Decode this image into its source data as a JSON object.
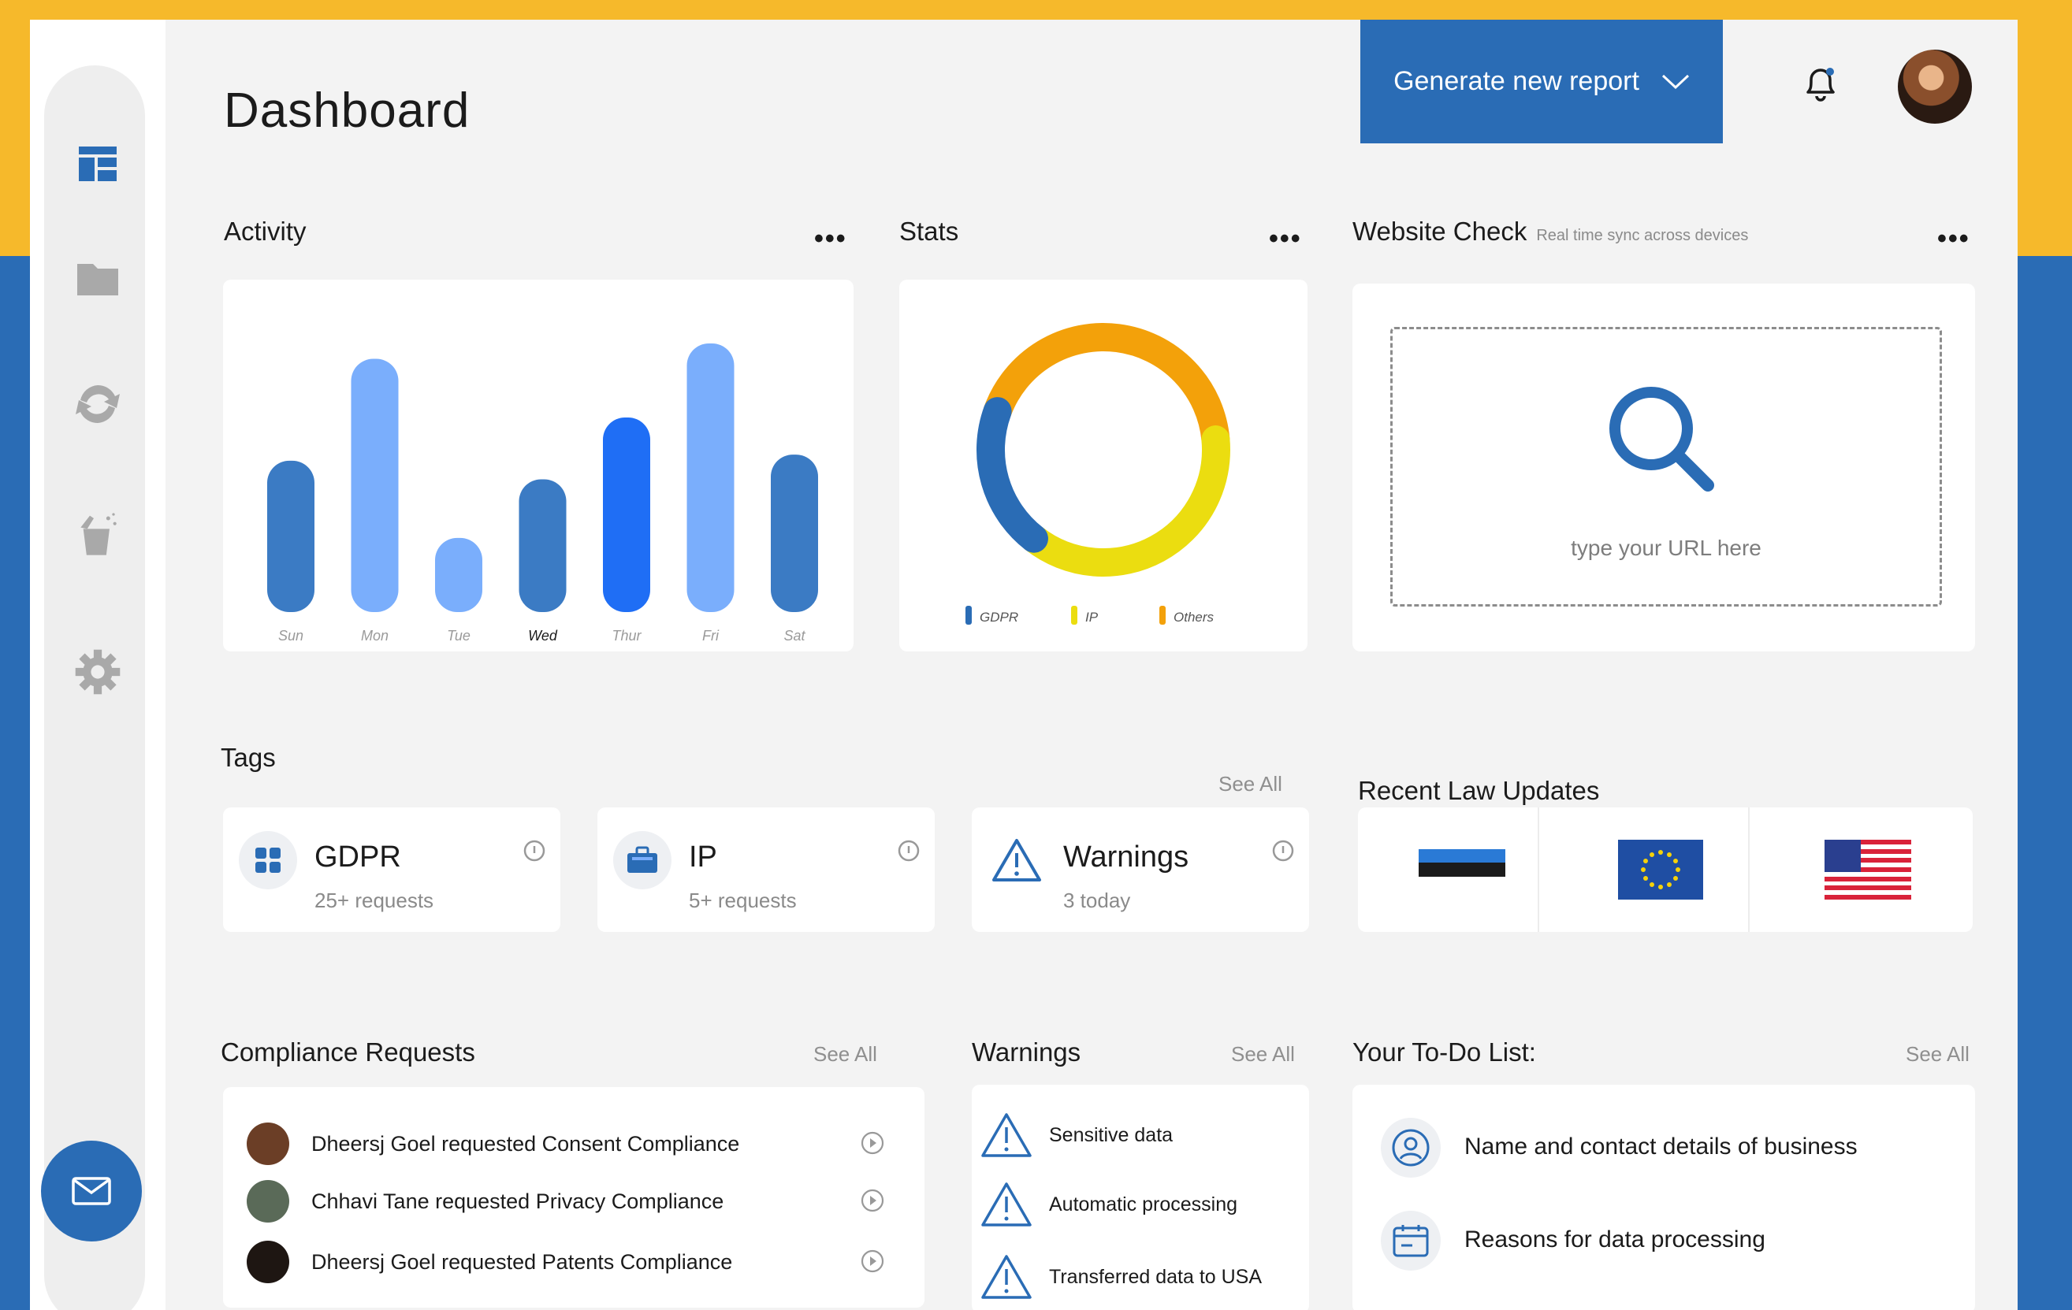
{
  "header": {
    "title": "Dashboard",
    "generate_button": "Generate new report"
  },
  "activity": {
    "title": "Activity",
    "menu": "•••"
  },
  "stats": {
    "title": "Stats",
    "menu": "•••"
  },
  "website_check": {
    "title": "Website Check",
    "subtitle": "Real time sync across devices",
    "menu": "•••",
    "placeholder": "type your URL here"
  },
  "tags": {
    "title": "Tags",
    "see_all": "See All",
    "items": [
      {
        "name": "GDPR",
        "sub": "25+ requests",
        "icon": "grid-icon"
      },
      {
        "name": "IP",
        "sub": "5+ requests",
        "icon": "briefcase-icon"
      },
      {
        "name": "Warnings",
        "sub": "3 today",
        "icon": "warning-icon"
      }
    ]
  },
  "law_updates": {
    "title": "Recent Law Updates",
    "flags": [
      "estonia-flag-icon",
      "eu-flag-icon",
      "usa-flag-icon"
    ]
  },
  "compliance": {
    "title": "Compliance Requests",
    "see_all": "See All",
    "items": [
      {
        "text": "Dheersj Goel requested Consent Compliance",
        "avatar_color": "#6b3e26"
      },
      {
        "text": "Chhavi Tane requested Privacy Compliance",
        "avatar_color": "#5a6a58"
      },
      {
        "text": "Dheersj Goel requested Patents Compliance",
        "avatar_color": "#1e1612"
      }
    ]
  },
  "warnings": {
    "title": "Warnings",
    "see_all": "See All",
    "items": [
      {
        "text": "Sensitive data"
      },
      {
        "text": "Automatic processing"
      },
      {
        "text": "Transferred data to USA"
      }
    ]
  },
  "todo": {
    "title": "Your To-Do List:",
    "see_all": "See All",
    "items": [
      {
        "text": "Name and contact details of business",
        "icon": "user-circle-icon"
      },
      {
        "text": "Reasons for data processing",
        "icon": "calendar-icon"
      }
    ]
  },
  "colors": {
    "brand_blue": "#2a6cb5",
    "brand_yellow": "#f6b92b"
  },
  "chart_data": [
    {
      "type": "bar",
      "categories": [
        "Sun",
        "Mon",
        "Tue",
        "Wed",
        "Thur",
        "Fri",
        "Sat"
      ],
      "values": [
        49,
        82,
        24,
        43,
        63,
        87,
        51
      ],
      "colors": [
        "#3b7bc4",
        "#7aaefc",
        "#7aaefc",
        "#3b7bc4",
        "#1f6ef5",
        "#7aaefc",
        "#3b7bc4"
      ],
      "highlight": "Wed",
      "ylim": [
        0,
        100
      ]
    },
    {
      "type": "pie",
      "labels": [
        "GDPR",
        "IP",
        "Others"
      ],
      "values": [
        20,
        37,
        43
      ],
      "colors": [
        "#2a6cb5",
        "#ebdd10",
        "#f3a10a"
      ]
    }
  ]
}
